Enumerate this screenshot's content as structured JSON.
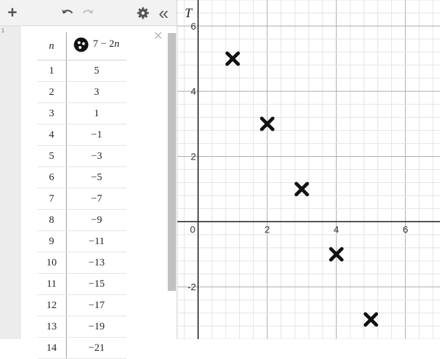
{
  "expression": {
    "index": "1",
    "table": {
      "headers": {
        "n": "n",
        "expr_part1": "7 − 2",
        "expr_var": "n"
      },
      "rows": [
        [
          "1",
          "5"
        ],
        [
          "2",
          "3"
        ],
        [
          "3",
          "1"
        ],
        [
          "4",
          "−1"
        ],
        [
          "5",
          "−3"
        ],
        [
          "6",
          "−5"
        ],
        [
          "7",
          "−7"
        ],
        [
          "8",
          "−9"
        ],
        [
          "9",
          "−11"
        ],
        [
          "10",
          "−13"
        ],
        [
          "11",
          "−15"
        ],
        [
          "12",
          "−17"
        ],
        [
          "13",
          "−19"
        ],
        [
          "14",
          "−21"
        ]
      ]
    }
  },
  "toolbar": {
    "add": "+",
    "undo_icon": "undo-icon",
    "redo_icon": "redo-icon",
    "settings_icon": "gear-icon",
    "collapse": "«"
  },
  "graph": {
    "y_axis_label": "T",
    "origin_label": "0",
    "x_ticks": [
      "2",
      "4",
      "6"
    ],
    "y_ticks": [
      "6",
      "4",
      "2",
      "-2"
    ],
    "x_range": [
      -0.6,
      7.0
    ],
    "y_range": [
      -3.6,
      6.8
    ],
    "grid": true,
    "marker_color": "#111111"
  },
  "chart_data": {
    "type": "scatter",
    "x": [
      1,
      2,
      3,
      4,
      5
    ],
    "y": [
      5,
      3,
      1,
      -1,
      -3
    ],
    "ylabel": "T",
    "xlabel": "",
    "xlim": [
      -0.6,
      7.0
    ],
    "ylim": [
      -3.6,
      6.8
    ],
    "grid": true,
    "marker": "cross"
  }
}
